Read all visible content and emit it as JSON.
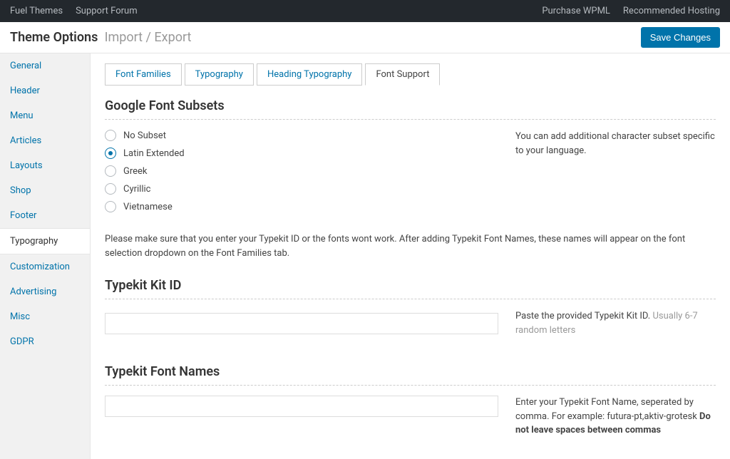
{
  "topbar": {
    "left": [
      "Fuel Themes",
      "Support Forum"
    ],
    "right": [
      "Purchase WPML",
      "Recommended Hosting"
    ]
  },
  "header": {
    "title": "Theme Options",
    "subtitle": "Import / Export",
    "save_label": "Save Changes"
  },
  "sidebar": {
    "items": [
      "General",
      "Header",
      "Menu",
      "Articles",
      "Layouts",
      "Shop",
      "Footer",
      "Typography",
      "Customization",
      "Advertising",
      "Misc",
      "GDPR"
    ],
    "active_index": 7
  },
  "tabs": {
    "items": [
      "Font Families",
      "Typography",
      "Heading Typography",
      "Font Support"
    ],
    "active_index": 3
  },
  "section_google_subsets": {
    "title": "Google Font Subsets",
    "options": [
      "No Subset",
      "Latin Extended",
      "Greek",
      "Cyrillic",
      "Vietnamese"
    ],
    "selected_index": 1,
    "help": "You can add additional character subset specific to your language."
  },
  "typekit_intro": "Please make sure that you enter your Typekit ID or the fonts wont work. After adding Typekit Font Names, these names will appear on the font selection dropdown on the Font Families tab.",
  "section_kit_id": {
    "title": "Typekit Kit ID",
    "value": "",
    "help_main": "Paste the provided Typekit Kit ID. ",
    "help_muted": "Usually 6-7 random letters"
  },
  "section_font_names": {
    "title": "Typekit Font Names",
    "value": "",
    "help_line1": "Enter your Typekit Font Name, seperated by comma. For example: futura-pt,aktiv-grotesk ",
    "help_bold": "Do not leave spaces between commas"
  }
}
